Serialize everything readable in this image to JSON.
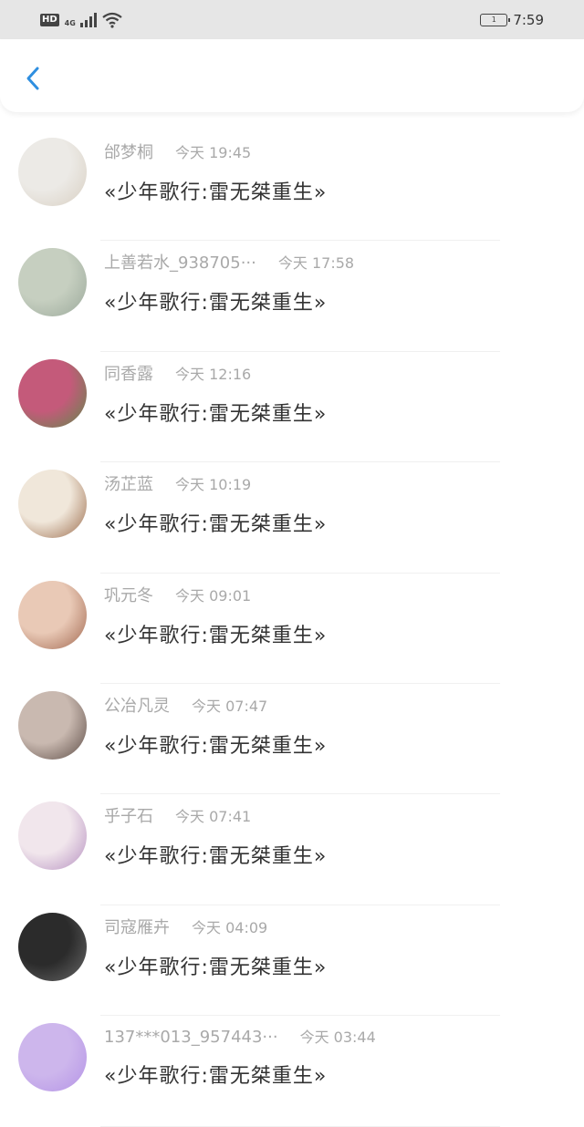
{
  "status_bar": {
    "hd": "HD",
    "network": "4G",
    "battery_level": "1",
    "time": "7:59"
  },
  "header": {
    "back_icon": "chevron-left-icon",
    "accent": "#2f8fe0"
  },
  "messages": [
    {
      "name": "邰梦桐",
      "time": "今天 19:45",
      "text": "«少年歌行:雷无桀重生»",
      "avatar_colors": [
        "#eceae6",
        "#d8cfc2"
      ]
    },
    {
      "name": "上善若水_938705···",
      "time": "今天 17:58",
      "text": "«少年歌行:雷无桀重生»",
      "avatar_colors": [
        "#c6cfc0",
        "#9aa89a"
      ]
    },
    {
      "name": "同香露",
      "time": "今天 12:16",
      "text": "«少年歌行:雷无桀重生»",
      "avatar_colors": [
        "#c45a7a",
        "#5f8a4a"
      ]
    },
    {
      "name": "汤芷蓝",
      "time": "今天 10:19",
      "text": "«少年歌行:雷无桀重生»",
      "avatar_colors": [
        "#f0e7da",
        "#9a6a4a"
      ]
    },
    {
      "name": "巩元冬",
      "time": "今天 09:01",
      "text": "«少年歌行:雷无桀重生»",
      "avatar_colors": [
        "#e9c9b6",
        "#a0664e"
      ]
    },
    {
      "name": "公冶凡灵",
      "time": "今天 07:47",
      "text": "«少年歌行:雷无桀重生»",
      "avatar_colors": [
        "#c9b9b0",
        "#5b4a44"
      ]
    },
    {
      "name": "乎子石",
      "time": "今天 07:41",
      "text": "«少年歌行:雷无桀重生»",
      "avatar_colors": [
        "#f1e6ec",
        "#b58fc0"
      ]
    },
    {
      "name": "司寇雁卉",
      "time": "今天 04:09",
      "text": "«少年歌行:雷无桀重生»",
      "avatar_colors": [
        "#2b2b2b",
        "#6a6a6a"
      ]
    },
    {
      "name": "137***013_957443···",
      "time": "今天 03:44",
      "text": "«少年歌行:雷无桀重生»",
      "avatar_colors": [
        "#cdb6ec",
        "#b493e6"
      ]
    }
  ]
}
